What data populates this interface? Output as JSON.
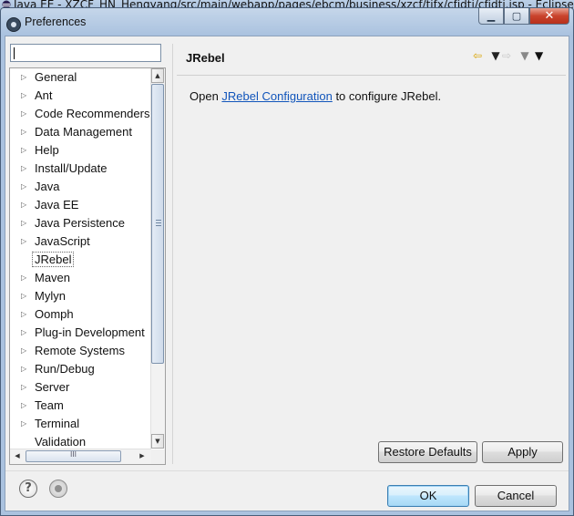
{
  "background_window": {
    "title": "Java EE - XZCF_HN_Hengyang/src/main/webapp/pages/ebcm/business/xzcf/tjfx/cfjdtj/cfjdtj.jsp - Eclipse"
  },
  "dialog": {
    "title": "Preferences",
    "window_buttons": {
      "minimize": "▁",
      "maximize": "▢",
      "close": "✕"
    }
  },
  "filter": {
    "value": "",
    "placeholder": ""
  },
  "tree": {
    "items": [
      {
        "label": "General",
        "expandable": true
      },
      {
        "label": "Ant",
        "expandable": true
      },
      {
        "label": "Code Recommenders",
        "expandable": true
      },
      {
        "label": "Data Management",
        "expandable": true
      },
      {
        "label": "Help",
        "expandable": true
      },
      {
        "label": "Install/Update",
        "expandable": true
      },
      {
        "label": "Java",
        "expandable": true
      },
      {
        "label": "Java EE",
        "expandable": true
      },
      {
        "label": "Java Persistence",
        "expandable": true
      },
      {
        "label": "JavaScript",
        "expandable": true
      },
      {
        "label": "JRebel",
        "expandable": false,
        "selected": true
      },
      {
        "label": "Maven",
        "expandable": true
      },
      {
        "label": "Mylyn",
        "expandable": true
      },
      {
        "label": "Oomph",
        "expandable": true
      },
      {
        "label": "Plug-in Development",
        "expandable": true
      },
      {
        "label": "Remote Systems",
        "expandable": true
      },
      {
        "label": "Run/Debug",
        "expandable": true
      },
      {
        "label": "Server",
        "expandable": true
      },
      {
        "label": "Team",
        "expandable": true
      },
      {
        "label": "Terminal",
        "expandable": true
      },
      {
        "label": "Validation",
        "expandable": false
      }
    ]
  },
  "page": {
    "title": "JRebel",
    "text_before": "Open ",
    "link": "JRebel Configuration",
    "text_after": " to configure JRebel.",
    "nav": {
      "back_icon": "back-arrow-icon",
      "forward_icon": "forward-arrow-icon",
      "menu_icon": "view-menu-icon"
    }
  },
  "buttons": {
    "restore_defaults": "Restore Defaults",
    "apply": "Apply",
    "ok": "OK",
    "cancel": "Cancel",
    "help_glyph": "?"
  },
  "colors": {
    "link": "#1155bb",
    "close_button": "#c9432c",
    "title_bar": "#aac2df"
  }
}
